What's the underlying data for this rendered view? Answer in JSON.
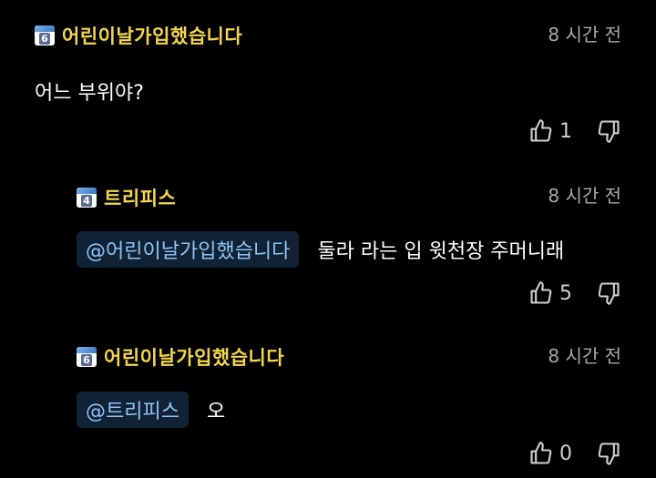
{
  "comments": [
    {
      "level": "6",
      "nick": "어린이날가입했습니다",
      "time": "8 시간 전",
      "text": "어느 부위야?",
      "mention": "",
      "likes": "1"
    },
    {
      "level": "4",
      "nick": "트리피스",
      "time": "8 시간 전",
      "mention": "@어린이날가입했습니다",
      "text": "둘라 라는 입 윗천장 주머니래",
      "likes": "5"
    },
    {
      "level": "6",
      "nick": "어린이날가입했습니다",
      "time": "8 시간 전",
      "mention": "@트리피스",
      "text": "오",
      "likes": "0"
    }
  ],
  "icons": {
    "like": "thumbs-up-icon",
    "dislike": "thumbs-down-icon",
    "badge": "level-badge-icon"
  },
  "colors": {
    "nick": "#f2d64b",
    "mention": "#8fc3f5",
    "time": "#a9a9a9"
  }
}
